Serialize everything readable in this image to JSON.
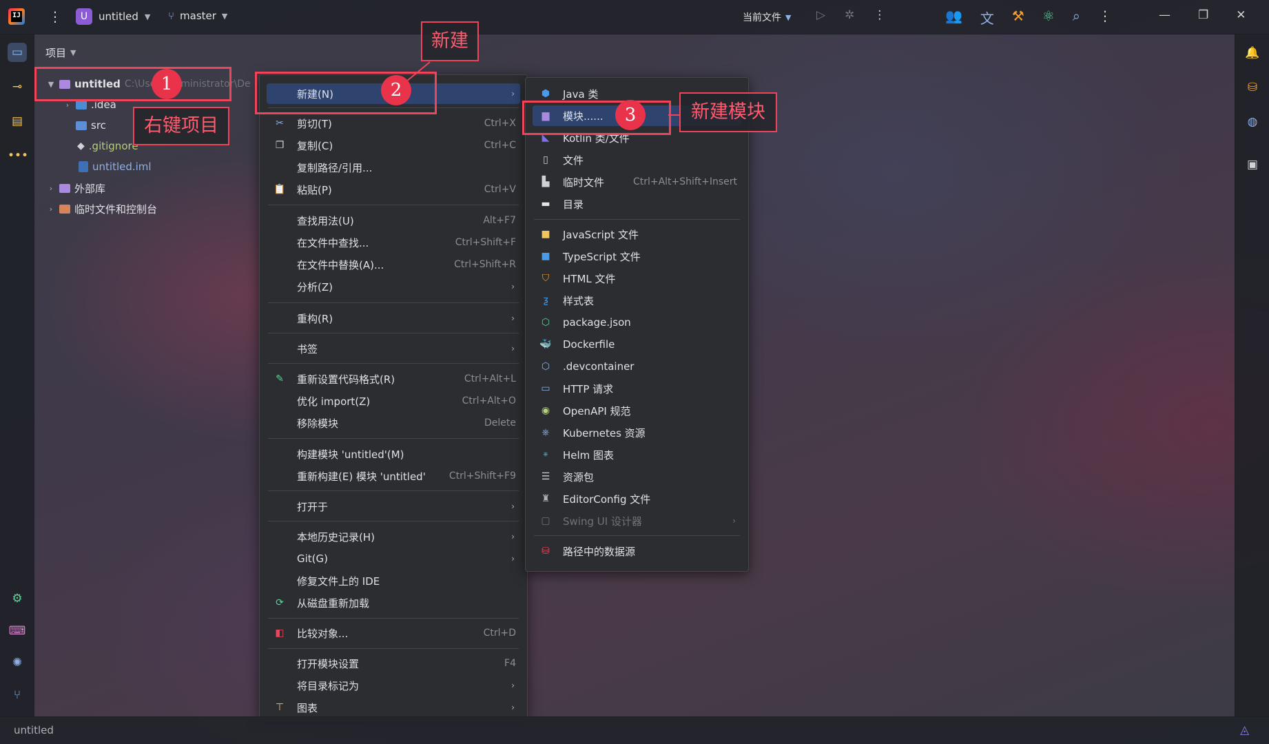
{
  "window": {
    "project_badge": "U",
    "project_name": "untitled",
    "branch": "master",
    "run_config": "当前文件",
    "menu_glyph": "⋮"
  },
  "project_panel": {
    "title": "项目",
    "tree": [
      {
        "label": "untitled",
        "path_hint": "C:\\Users\\Administrator\\De"
      },
      {
        "label": ".idea"
      },
      {
        "label": "src"
      },
      {
        "label": ".gitignore"
      },
      {
        "label": "untitled.iml"
      },
      {
        "label": "外部库"
      },
      {
        "label": "临时文件和控制台"
      }
    ]
  },
  "context_menu": {
    "items": [
      {
        "label": "新建(N)",
        "shortcut": "",
        "submenu": true,
        "selected": true
      },
      {
        "label": "剪切(T)",
        "shortcut": "Ctrl+X"
      },
      {
        "label": "复制(C)",
        "shortcut": "Ctrl+C"
      },
      {
        "label": "复制路径/引用...",
        "shortcut": ""
      },
      {
        "label": "粘贴(P)",
        "shortcut": "Ctrl+V"
      },
      {
        "label": "查找用法(U)",
        "shortcut": "Alt+F7"
      },
      {
        "label": "在文件中查找...",
        "shortcut": "Ctrl+Shift+F"
      },
      {
        "label": "在文件中替换(A)...",
        "shortcut": "Ctrl+Shift+R"
      },
      {
        "label": "分析(Z)",
        "shortcut": "",
        "submenu": true
      },
      {
        "label": "重构(R)",
        "shortcut": "",
        "submenu": true
      },
      {
        "label": "书签",
        "shortcut": "",
        "submenu": true
      },
      {
        "label": "重新设置代码格式(R)",
        "shortcut": "Ctrl+Alt+L"
      },
      {
        "label": "优化 import(Z)",
        "shortcut": "Ctrl+Alt+O"
      },
      {
        "label": "移除模块",
        "shortcut": "Delete"
      },
      {
        "label": "构建模块 'untitled'(M)",
        "shortcut": ""
      },
      {
        "label": "重新构建(E) 模块 'untitled'",
        "shortcut": "Ctrl+Shift+F9"
      },
      {
        "label": "打开于",
        "shortcut": "",
        "submenu": true
      },
      {
        "label": "本地历史记录(H)",
        "shortcut": "",
        "submenu": true
      },
      {
        "label": "Git(G)",
        "shortcut": "",
        "submenu": true
      },
      {
        "label": "修复文件上的 IDE",
        "shortcut": ""
      },
      {
        "label": "从磁盘重新加载",
        "shortcut": ""
      },
      {
        "label": "比较对象...",
        "shortcut": "Ctrl+D"
      },
      {
        "label": "打开模块设置",
        "shortcut": "F4"
      },
      {
        "label": "将目录标记为",
        "shortcut": "",
        "submenu": true
      },
      {
        "label": "图表",
        "shortcut": "",
        "submenu": true
      }
    ]
  },
  "new_submenu": {
    "items": [
      {
        "label": "Java 类",
        "shortcut": ""
      },
      {
        "label": "模块......",
        "shortcut": "",
        "selected": true
      },
      {
        "label": "Kotlin 类/文件",
        "shortcut": ""
      },
      {
        "label": "文件",
        "shortcut": ""
      },
      {
        "label": "临时文件",
        "shortcut": "Ctrl+Alt+Shift+Insert"
      },
      {
        "label": "目录",
        "shortcut": ""
      },
      {
        "label": "JavaScript 文件",
        "shortcut": ""
      },
      {
        "label": "TypeScript 文件",
        "shortcut": ""
      },
      {
        "label": "HTML 文件",
        "shortcut": ""
      },
      {
        "label": "样式表",
        "shortcut": ""
      },
      {
        "label": "package.json",
        "shortcut": ""
      },
      {
        "label": "Dockerfile",
        "shortcut": ""
      },
      {
        "label": ".devcontainer",
        "shortcut": ""
      },
      {
        "label": "HTTP 请求",
        "shortcut": ""
      },
      {
        "label": "OpenAPI 规范",
        "shortcut": ""
      },
      {
        "label": "Kubernetes 资源",
        "shortcut": ""
      },
      {
        "label": "Helm 图表",
        "shortcut": ""
      },
      {
        "label": "资源包",
        "shortcut": ""
      },
      {
        "label": "EditorConfig 文件",
        "shortcut": ""
      },
      {
        "label": "Swing UI 设计器",
        "shortcut": "",
        "disabled": true,
        "submenu": true
      },
      {
        "label": "路径中的数据源",
        "shortcut": ""
      }
    ]
  },
  "annotations": {
    "step1_label": "右键项目",
    "step2_label": "新建",
    "step3_label": "新建模块",
    "step1_num": "1",
    "step2_num": "2",
    "step3_num": "3"
  },
  "status_bar": {
    "text": "untitled"
  },
  "colors": {
    "accent": "#2e436e",
    "annotation": "#f0445a",
    "menu_bg": "#2b2d30"
  }
}
